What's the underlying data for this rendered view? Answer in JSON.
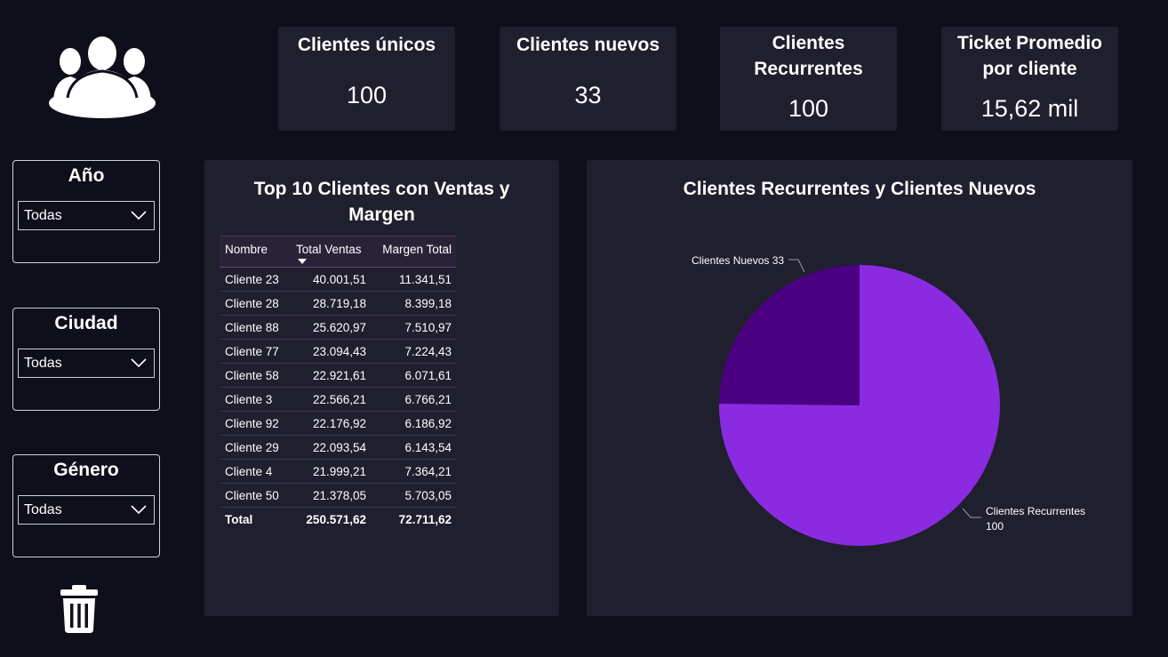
{
  "kpis": [
    {
      "title": "Clientes únicos",
      "value": "100"
    },
    {
      "title": "Clientes nuevos",
      "value": "33"
    },
    {
      "title": "Clientes Recurrentes",
      "value": "100"
    },
    {
      "title": "Ticket Promedio por cliente",
      "value": "15,62 mil"
    }
  ],
  "filters": {
    "anio": {
      "label": "Año",
      "value": "Todas"
    },
    "ciudad": {
      "label": "Ciudad",
      "value": "Todas"
    },
    "genero": {
      "label": "Género",
      "value": "Todas"
    }
  },
  "icons": {
    "header": "people-group-icon",
    "clear": "trash-icon",
    "dropdown": "chevron-down-icon"
  },
  "table": {
    "title": "Top 10 Clientes con Ventas y Margen",
    "columns": [
      "Nombre",
      "Total Ventas",
      "Margen Total"
    ],
    "sorted_column": "Total Ventas",
    "rows": [
      [
        "Cliente 23",
        "40.001,51",
        "11.341,51"
      ],
      [
        "Cliente 28",
        "28.719,18",
        "8.399,18"
      ],
      [
        "Cliente 88",
        "25.620,97",
        "7.510,97"
      ],
      [
        "Cliente 77",
        "23.094,43",
        "7.224,43"
      ],
      [
        "Cliente 58",
        "22.921,61",
        "6.071,61"
      ],
      [
        "Cliente 3",
        "22.566,21",
        "6.766,21"
      ],
      [
        "Cliente 92",
        "22.176,92",
        "6.186,92"
      ],
      [
        "Cliente 29",
        "22.093,54",
        "6.143,54"
      ],
      [
        "Cliente 4",
        "21.999,21",
        "7.364,21"
      ],
      [
        "Cliente 50",
        "21.378,05",
        "5.703,05"
      ]
    ],
    "total": [
      "Total",
      "250.571,62",
      "72.711,62"
    ]
  },
  "chart_data": {
    "type": "pie",
    "title": "Clientes Recurrentes y Clientes Nuevos",
    "slices": [
      {
        "name": "Clientes Nuevos",
        "value": 33,
        "label": "Clientes Nuevos 33",
        "color": "#4b0082"
      },
      {
        "name": "Clientes Recurrentes",
        "value": 100,
        "label": "Clientes Recurrentes 100",
        "color": "#8a2be2"
      }
    ]
  },
  "colors": {
    "background": "#0f0f1b",
    "panel": "#1f1f2e",
    "accent_dark": "#4b0082",
    "accent": "#8a2be2"
  }
}
